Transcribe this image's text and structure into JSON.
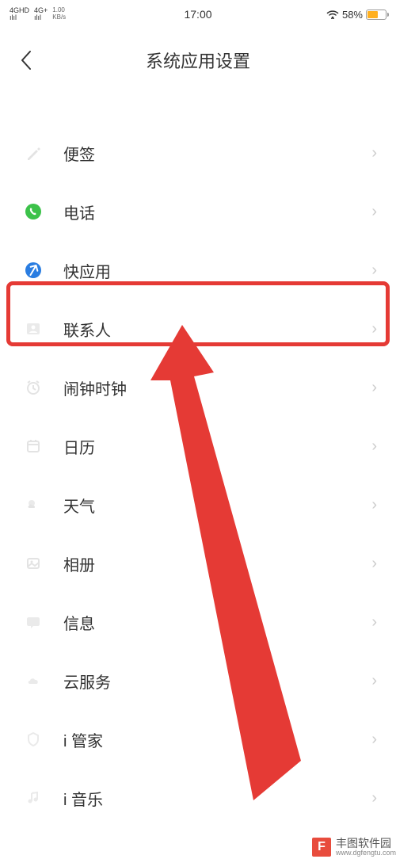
{
  "status_bar": {
    "signal1": "4GHD",
    "signal1_bars": "ılıl",
    "signal2": "4G+",
    "signal2_bars": "ılıl",
    "speed_value": "1.00",
    "speed_unit": "KB/s",
    "time": "17:00",
    "battery_pct": "58%"
  },
  "header": {
    "title": "系统应用设置"
  },
  "items": [
    {
      "label": "便签"
    },
    {
      "label": "电话"
    },
    {
      "label": "快应用"
    },
    {
      "label": "联系人"
    },
    {
      "label": "闹钟时钟"
    },
    {
      "label": "日历"
    },
    {
      "label": "天气"
    },
    {
      "label": "相册"
    },
    {
      "label": "信息"
    },
    {
      "label": "云服务"
    },
    {
      "label": "i 管家"
    },
    {
      "label": "i 音乐"
    }
  ],
  "watermark": {
    "logo_letter": "F",
    "name": "丰图软件园",
    "url": "www.dgfengtu.com"
  },
  "annotation": {
    "highlight_index": 3,
    "highlight_color": "#e53a35"
  }
}
